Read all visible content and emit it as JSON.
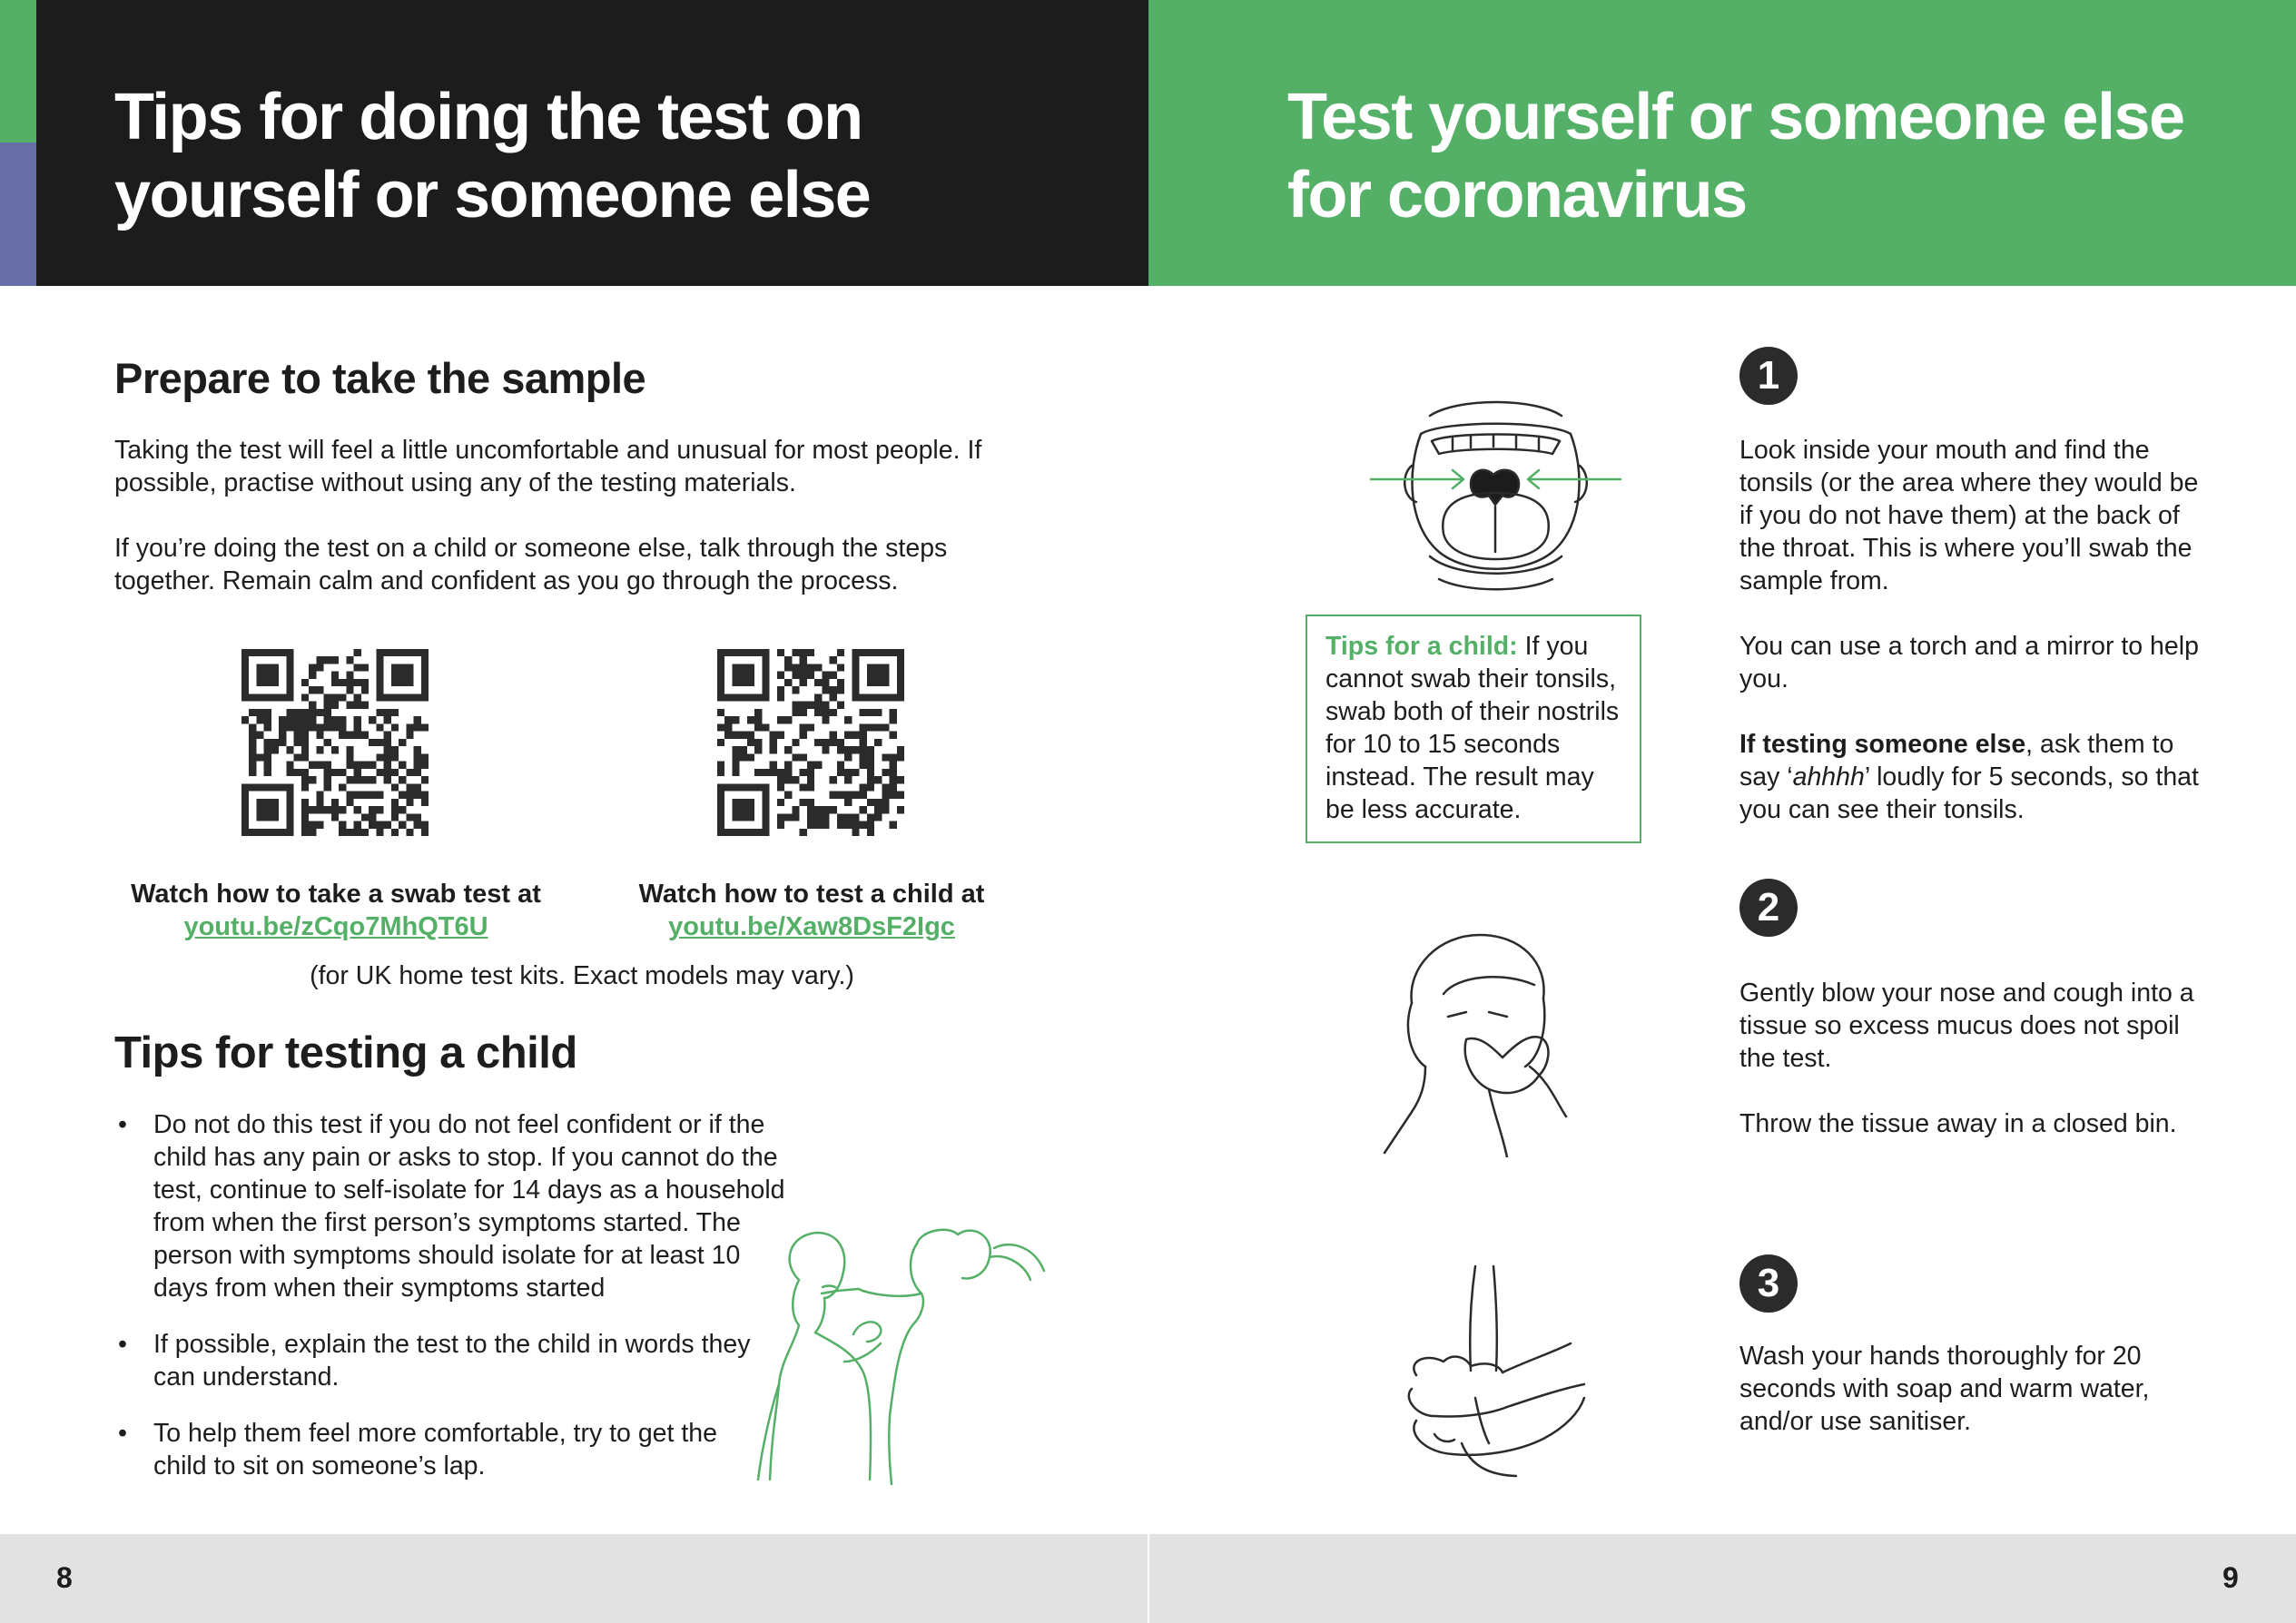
{
  "left_page": {
    "title": "Tips for doing the test on yourself or someone else",
    "prepare": {
      "heading": "Prepare to take the sample",
      "para1": "Taking the test will feel a little uncomfortable and unusual for most people. If possible, practise without using any of the testing materials.",
      "para2": "If you’re doing the test on a child or someone else, talk through the steps together. Remain calm and confident as you go through the process."
    },
    "videos": [
      {
        "caption": "Watch how to take a swab test at",
        "link": "youtu.be/zCqo7MhQT6U"
      },
      {
        "caption": "Watch how to test a child at",
        "link": "youtu.be/Xaw8DsF2Igc"
      }
    ],
    "kits_note": "(for UK home test kits. Exact models may vary.)",
    "child_tips": {
      "heading": "Tips for testing a child",
      "bullet_symbol": "•",
      "bullets": [
        "Do not do this test if you do not feel confident or if the child has any pain or asks to stop. If you cannot do the test, continue to self-isolate for 14 days as a household from when the first person’s symptoms started. The person with symptoms should isolate for at least 10 days from when their symptoms started",
        "If possible, explain the test to the child in words they can understand.",
        "To help them feel more comfortable, try to get the child to sit on someone’s lap."
      ]
    },
    "page_number": "8"
  },
  "right_page": {
    "title": "Test yourself or someone else for coronavirus",
    "steps": [
      {
        "number": "1",
        "text": "Look inside your mouth and find the tonsils (or the area where they would be if you do not have them) at the back of the throat. This is where you’ll swab the sample from.",
        "text2": "You can use a torch and a mirror to help you.",
        "text3_bold": "If testing someone else",
        "text3_pre": ", ask them to say ‘",
        "text3_italic": "ahhhh",
        "text3_post": "’ loudly for 5 seconds, so that you can see their tonsils."
      },
      {
        "number": "2",
        "text": "Gently blow your nose and cough into a tissue so excess mucus does not spoil the test.",
        "text2": "Throw the tissue away in a closed bin."
      },
      {
        "number": "3",
        "text": "Wash your hands thoroughly for 20 seconds with soap and warm water, and/or use sanitiser."
      }
    ],
    "tips_box": {
      "lead": "Tips for a child:",
      "text": " If you cannot swab their tonsils, swab both of their nostrils for 10 to 15 seconds instead. The result may be less accurate."
    },
    "page_number": "9"
  },
  "colors": {
    "green": "#55b067",
    "dark": "#1c1c1c",
    "purple": "#676ea8",
    "footer_grey": "#e2e2e2"
  }
}
